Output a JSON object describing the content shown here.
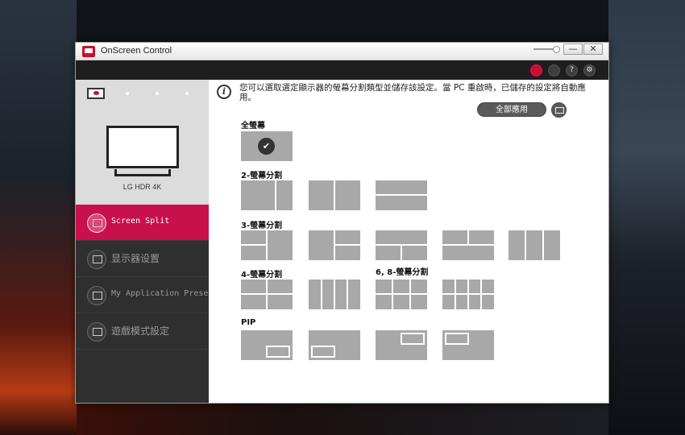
{
  "window": {
    "title": "OnScreen Control",
    "minimize": "—",
    "close": "✕"
  },
  "toolbar": {
    "icons": [
      "cursor-icon",
      "display-icon",
      "help-icon",
      "settings-icon"
    ],
    "help_glyph": "?",
    "settings_glyph": "⚙"
  },
  "sidebar": {
    "monitor_name": "LG HDR 4K",
    "items": [
      {
        "label": "Screen Split",
        "icon": "screen-split-icon",
        "active": true
      },
      {
        "label": "显示器设置",
        "icon": "monitor-settings-icon",
        "active": false
      },
      {
        "label": "My Application Preset",
        "icon": "app-preset-icon",
        "active": false
      },
      {
        "label": "遊戲模式設定",
        "icon": "gamepad-icon",
        "active": false
      }
    ]
  },
  "main": {
    "info_text": "您可以選取選定顯示器的螢幕分割類型並儲存該設定。當 PC 重啟時，已儲存的設定將自動應用。",
    "apply_all": "全部應用",
    "check": "✔",
    "sections": {
      "full": "全螢幕",
      "split2": "2-螢幕分割",
      "split3": "3-螢幕分割",
      "split4": "4-螢幕分割",
      "split68": "6, 8-螢幕分割",
      "pip": "PIP"
    }
  },
  "colors": {
    "accent": "#c8104c",
    "sidebar_bg": "#2f2f2f",
    "toolbar_bg": "#1e1e1e",
    "layout_tile": "#a8a8a8"
  }
}
